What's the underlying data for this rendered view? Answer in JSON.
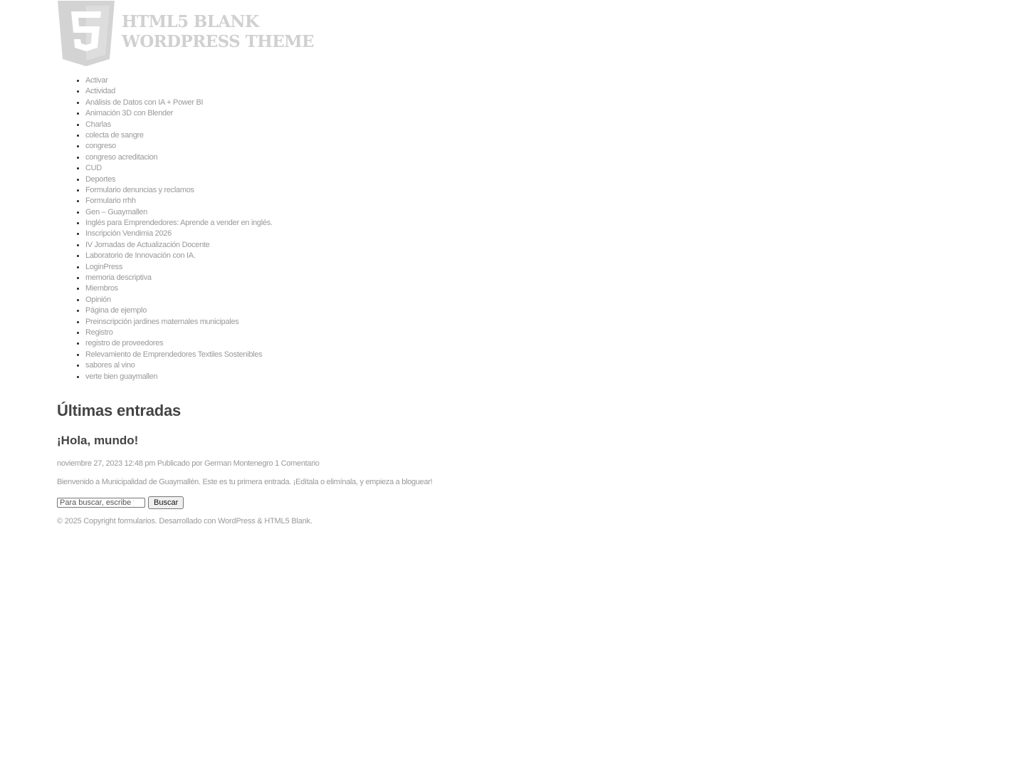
{
  "header": {
    "logo_icon": "html5-shield-icon",
    "logo_line1": "HTML5 BLANK",
    "logo_line2": "WORDPRESS THEME",
    "logo_color": "#d0d0d0"
  },
  "nav": {
    "items": [
      "Activar",
      "Actividad",
      "Análisis de Datos con IA + Power BI",
      "Animación 3D con Blender",
      "Charlas",
      "colecta de sangre",
      "congreso",
      "congreso acreditacion",
      "CUD",
      "Deportes",
      "Formulario denuncias y reclamos",
      "Formulario rrhh",
      "Gen – Guaymallen",
      "Inglés para Emprendedores: Aprende a vender en inglés.",
      "Inscripción Vendimia 2026",
      "IV Jornadas de Actualización Docente",
      "Laboratorio de Innovación con IA.",
      "LoginPress",
      "memoria descriptiva",
      "Miembros",
      "Opinión",
      "Página de ejemplo",
      "Preinscripción jardines maternales municipales",
      "Registro",
      "registro de proveedores",
      "Relevamiento de Emprendedores Textiles Sostenibles",
      "sabores al vino",
      "verte bien guaymallen"
    ]
  },
  "main": {
    "title": "Últimas entradas",
    "post": {
      "title": "¡Hola, mundo!",
      "date": "noviembre 27, 2023 12:48 pm",
      "author_prefix": "Publicado por",
      "author": "German Montenegro",
      "comments": "1 Comentario",
      "excerpt": "Bienvenido a Municipalidad de Guaymallén. Este es tu primera entrada. ¡Edítala o elimínala, y empieza a bloguear!"
    }
  },
  "search": {
    "placeholder": "Para buscar, escribe y pulsa Enter.",
    "button_label": "Buscar"
  },
  "footer": {
    "copyright": "© 2025 Copyright formularios. Desarrollado con",
    "wordpress": "WordPress",
    "amp": "&",
    "html5blank": "HTML5 Blank",
    "period": "."
  }
}
